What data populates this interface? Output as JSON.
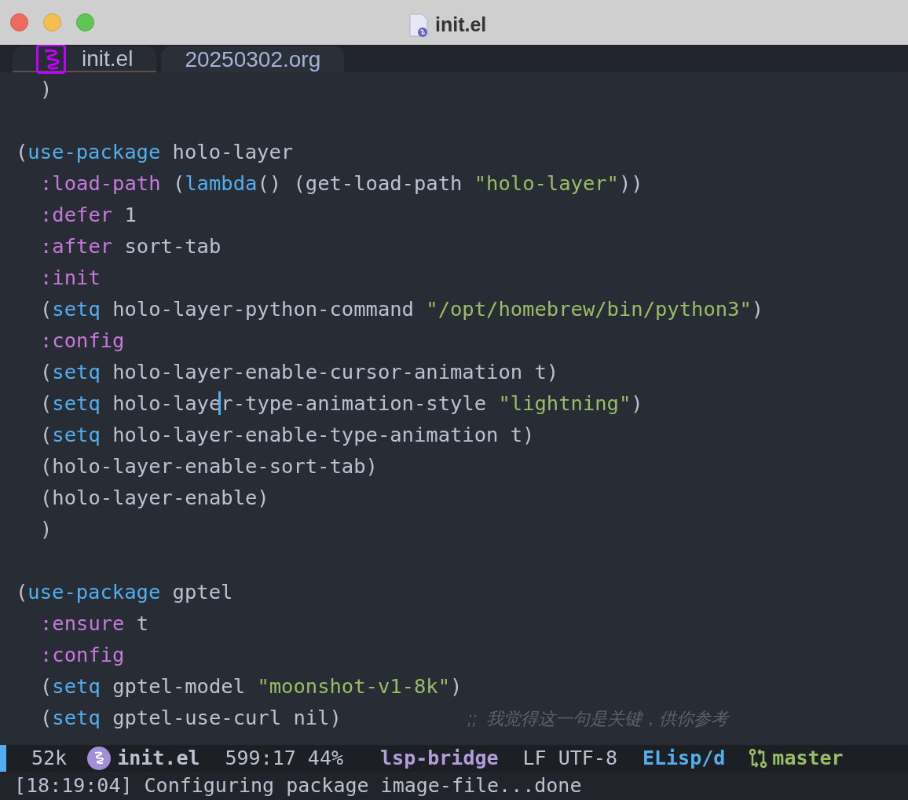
{
  "window": {
    "title": "init.el"
  },
  "tabs": [
    {
      "label": "init.el",
      "selected": true
    },
    {
      "label": "20250302.org",
      "selected": false
    }
  ],
  "code_lines": [
    {
      "kind": "code",
      "indented": true,
      "tokens": [
        {
          "kind": "plain",
          "text": ")"
        }
      ]
    },
    {
      "kind": "blank"
    },
    {
      "kind": "code",
      "indented": false,
      "tokens": [
        {
          "kind": "plain",
          "text": "("
        },
        {
          "kind": "keyword",
          "text": "use-package"
        },
        {
          "kind": "plain",
          "text": " holo-layer"
        }
      ]
    },
    {
      "kind": "code",
      "indented": true,
      "tokens": [
        {
          "kind": "property",
          "text": ":load-path"
        },
        {
          "kind": "plain",
          "text": " ("
        },
        {
          "kind": "keyword",
          "text": "lambda"
        },
        {
          "kind": "plain",
          "text": "() (get-load-path "
        },
        {
          "kind": "string",
          "text": "\"holo-layer\""
        },
        {
          "kind": "plain",
          "text": "))"
        }
      ]
    },
    {
      "kind": "code",
      "indented": true,
      "tokens": [
        {
          "kind": "property",
          "text": ":defer"
        },
        {
          "kind": "plain",
          "text": " 1"
        }
      ]
    },
    {
      "kind": "code",
      "indented": true,
      "tokens": [
        {
          "kind": "property",
          "text": ":after"
        },
        {
          "kind": "plain",
          "text": " sort-tab"
        }
      ]
    },
    {
      "kind": "code",
      "indented": true,
      "tokens": [
        {
          "kind": "property",
          "text": ":init"
        }
      ]
    },
    {
      "kind": "code",
      "indented": true,
      "tokens": [
        {
          "kind": "plain",
          "text": "("
        },
        {
          "kind": "keyword",
          "text": "setq"
        },
        {
          "kind": "plain",
          "text": " holo-layer-python-command "
        },
        {
          "kind": "string",
          "text": "\"/opt/homebrew/bin/python3\""
        },
        {
          "kind": "plain",
          "text": ")"
        }
      ]
    },
    {
      "kind": "code",
      "indented": true,
      "tokens": [
        {
          "kind": "property",
          "text": ":config"
        }
      ]
    },
    {
      "kind": "code",
      "indented": true,
      "tokens": [
        {
          "kind": "plain",
          "text": "("
        },
        {
          "kind": "keyword",
          "text": "setq"
        },
        {
          "kind": "plain",
          "text": " holo-layer-enable-cursor-animation t)"
        }
      ]
    },
    {
      "kind": "code",
      "indented": true,
      "tokens": [
        {
          "kind": "plain",
          "text": "("
        },
        {
          "kind": "keyword",
          "text": "setq"
        },
        {
          "kind": "plain",
          "text": " holo-laye"
        },
        {
          "kind": "cursor",
          "text": "r"
        },
        {
          "kind": "plain",
          "text": "-type-animation-style "
        },
        {
          "kind": "string",
          "text": "\"lightning\""
        },
        {
          "kind": "plain",
          "text": ")"
        }
      ]
    },
    {
      "kind": "code",
      "indented": true,
      "tokens": [
        {
          "kind": "plain",
          "text": "("
        },
        {
          "kind": "keyword",
          "text": "setq"
        },
        {
          "kind": "plain",
          "text": " holo-layer-enable-type-animation t)"
        }
      ]
    },
    {
      "kind": "code",
      "indented": true,
      "tokens": [
        {
          "kind": "plain",
          "text": "(holo-layer-enable-sort-tab)"
        }
      ]
    },
    {
      "kind": "code",
      "indented": true,
      "tokens": [
        {
          "kind": "plain",
          "text": "(holo-layer-enable)"
        }
      ]
    },
    {
      "kind": "code",
      "indented": true,
      "tokens": [
        {
          "kind": "plain",
          "text": ")"
        }
      ]
    },
    {
      "kind": "blank"
    },
    {
      "kind": "code",
      "indented": false,
      "tokens": [
        {
          "kind": "plain",
          "text": "("
        },
        {
          "kind": "keyword",
          "text": "use-package"
        },
        {
          "kind": "plain",
          "text": " gptel"
        }
      ]
    },
    {
      "kind": "code",
      "indented": true,
      "tokens": [
        {
          "kind": "property",
          "text": ":ensure"
        },
        {
          "kind": "plain",
          "text": " t"
        }
      ]
    },
    {
      "kind": "code",
      "indented": true,
      "tokens": [
        {
          "kind": "property",
          "text": ":config"
        }
      ]
    },
    {
      "kind": "code",
      "indented": true,
      "tokens": [
        {
          "kind": "plain",
          "text": "("
        },
        {
          "kind": "keyword",
          "text": "setq"
        },
        {
          "kind": "plain",
          "text": " gptel-model "
        },
        {
          "kind": "string",
          "text": "\"moonshot-v1-8k\""
        },
        {
          "kind": "plain",
          "text": ")"
        }
      ]
    },
    {
      "kind": "code",
      "indented": true,
      "tokens": [
        {
          "kind": "plain",
          "text": "("
        },
        {
          "kind": "keyword",
          "text": "setq"
        },
        {
          "kind": "plain",
          "text": " gptel-use-curl nil)"
        },
        {
          "kind": "comment",
          "text": ";;  我觉得这一句是关键，供你参考"
        }
      ]
    }
  ],
  "mode_line": {
    "size": "52k",
    "buffer": "init.el",
    "position": "599:17 44%",
    "lsp": "lsp-bridge",
    "encoding": "LF UTF-8",
    "major_mode": "ELisp/d",
    "branch": "master"
  },
  "echo_area": "[18:19:04] Configuring package image-file...done"
}
